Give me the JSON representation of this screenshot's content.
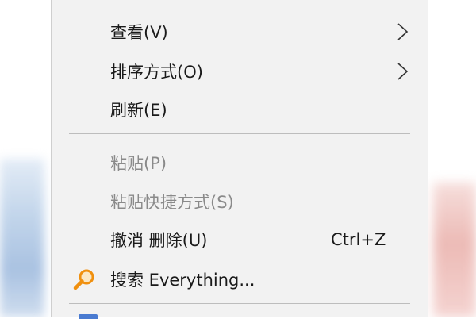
{
  "context_menu": {
    "items": [
      {
        "label": "查看(V)",
        "has_submenu": true,
        "enabled": true
      },
      {
        "label": "排序方式(O)",
        "has_submenu": true,
        "enabled": true
      },
      {
        "label": "刷新(E)",
        "has_submenu": false,
        "enabled": true
      },
      {
        "label": "粘贴(P)",
        "has_submenu": false,
        "enabled": false
      },
      {
        "label": "粘贴快捷方式(S)",
        "has_submenu": false,
        "enabled": false
      },
      {
        "label": "撤消 删除(U)",
        "shortcut": "Ctrl+Z",
        "has_submenu": false,
        "enabled": true
      },
      {
        "label": "搜索 Everything...",
        "icon": "search-magnifier-icon",
        "has_submenu": false,
        "enabled": true
      }
    ]
  },
  "colors": {
    "menu_background": "#f2f2f2",
    "text_enabled": "#1a1a1a",
    "text_disabled": "#8a8a8a",
    "separator": "#bdbdbd",
    "everything_icon": "#f0900f"
  }
}
